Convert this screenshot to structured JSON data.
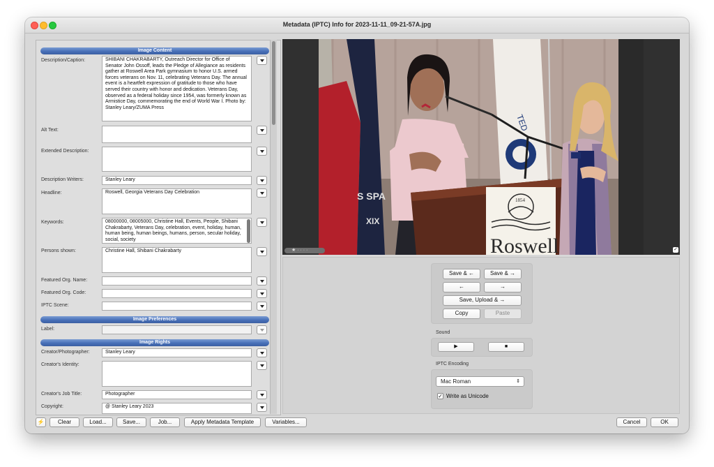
{
  "window": {
    "title": "Metadata (IPTC) Info for 2023-11-11_09-21-57A.jpg"
  },
  "sections": {
    "image_content": "Image Content",
    "image_preferences": "Image Preferences",
    "image_rights": "Image Rights"
  },
  "fields": {
    "description": {
      "label": "Description/Caption:",
      "value": "SHIBANI CHAKRABARTY, Outreach Director for Office of Senator John Ossoff, leads the Pledge of Allegiance as residents gather at Roswell Area Park gymnasium to honor U.S. armed forces veterans on Nov. 11, celebrating Veterans Day. The annual event is a heartfelt expression of gratitude to those who have served their country with honor and dedication. Veterans Day, observed as a federal holiday since 1954, was formerly known as Armistice Day, commemorating the end of World War I. Photo by: Stanley Leary/ZUMA Press"
    },
    "alt_text": {
      "label": "Alt Text:",
      "value": ""
    },
    "extended_description": {
      "label": "Extended Description:",
      "value": ""
    },
    "description_writers": {
      "label": "Description Writers:",
      "value": "Stanley Leary"
    },
    "headline": {
      "label": "Headline:",
      "value": "Roswell, Georgia Veterans Day Celebration"
    },
    "keywords": {
      "label": "Keywords:",
      "value": "08000000, 08005000, Christine Hall, Events, People, Shibani Chakrabarty, Veterans Day, celebration, event, holiday, human, human being, human beings, humans, person, secular holiday, social, society"
    },
    "persons_shown": {
      "label": "Persons shown:",
      "value": "Christine Hall, Shibani Chakrabarty"
    },
    "featured_org_name": {
      "label": "Featured Org. Name:",
      "value": ""
    },
    "featured_org_code": {
      "label": "Featured Org. Code:",
      "value": ""
    },
    "iptc_scene": {
      "label": "IPTC Scene:",
      "value": ""
    },
    "label": {
      "label": "Label:",
      "value": ""
    },
    "creator": {
      "label": "Creator/Photographer:",
      "value": "Stanley Leary"
    },
    "creators_identity": {
      "label": "Creator's Identity:",
      "value": ""
    },
    "creators_job_title": {
      "label": "Creator's Job Title:",
      "value": "Photographer"
    },
    "copyright": {
      "label": "Copyright:",
      "value": "@ Stanley Leary 2023"
    }
  },
  "image": {
    "star_rating": "★ · · · ·",
    "check": "✓",
    "podium_year": "1854",
    "podium_text": "Roswell",
    "flag_text": "TED",
    "banner_text": "S SPA",
    "banner_text2": "XIX"
  },
  "nav": {
    "save_prev": "Save & ←",
    "save_next": "Save & →",
    "prev": "←",
    "next": "→",
    "save_upload_next": "Save, Upload & →",
    "copy": "Copy",
    "paste": "Paste"
  },
  "sound": {
    "header": "Sound",
    "play": "▶",
    "stop": "■"
  },
  "encoding": {
    "header": "IPTC Encoding",
    "selected": "Mac Roman",
    "unicode_label": "Write as Unicode",
    "unicode_checked": "✓"
  },
  "bottom": {
    "lightning": "⚡",
    "clear": "Clear",
    "load": "Load...",
    "save": "Save...",
    "job": "Job...",
    "apply_template": "Apply Metadata Template",
    "variables": "Variables...",
    "cancel": "Cancel",
    "ok": "OK"
  }
}
